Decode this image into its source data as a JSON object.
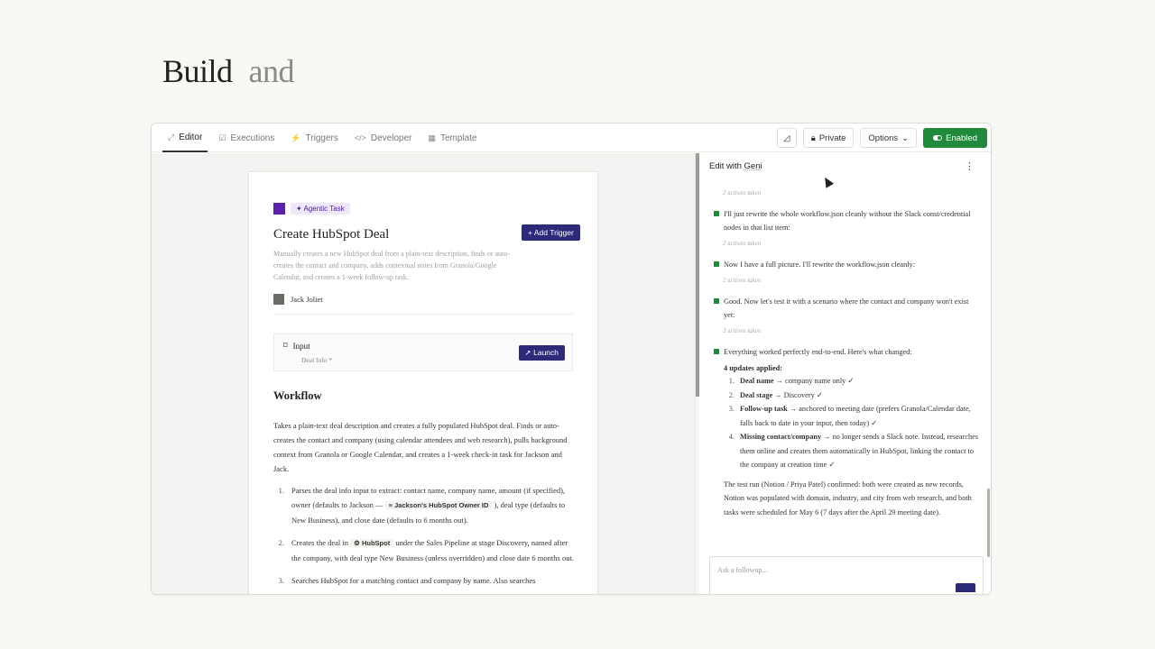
{
  "hero": {
    "word1": "Build",
    "word2": "and"
  },
  "tabs": [
    {
      "label": "Editor",
      "icon": "pencil-icon",
      "glyph": "⤢"
    },
    {
      "label": "Executions",
      "icon": "checkbox-icon",
      "glyph": "☑"
    },
    {
      "label": "Triggers",
      "icon": "lightning-icon",
      "glyph": "⚡"
    },
    {
      "label": "Developer",
      "icon": "code-icon",
      "glyph": "</>"
    },
    {
      "label": "Template",
      "icon": "grid-icon",
      "glyph": "▦"
    }
  ],
  "controls": {
    "private": "Private",
    "options": "Options",
    "enabled": "Enabled"
  },
  "card": {
    "badge": "Agentic Task",
    "add_trigger": "+ Add Trigger",
    "title": "Create HubSpot Deal",
    "description": "Manually creates a new HubSpot deal from a plain-text description, finds or auto-creates the contact and company, adds contextual notes from Granola/Google Calendar, and creates a 1-week follow-up task.",
    "author": "Jack Joliet",
    "input_label": "Input",
    "input_sub": "Deal Info *",
    "launch": "Launch",
    "workflow_title": "Workflow",
    "workflow_desc": "Takes a plain-text deal description and creates a fully populated HubSpot deal. Finds or auto-creates the contact and company (using calendar attendees and web research), pulls background context from Granola or Google Calendar, and creates a 1-week check-in task for Jackson and Jack.",
    "steps": [
      {
        "n": "1.",
        "a": "Parses the deal info input to extract: contact name, company name, amount (if specified), owner (defaults to Jackson —",
        "pill": "≡ Jackson's HubSpot Owner ID",
        "b": "), deal type (defaults to New Business), and close date (defaults to 6 months out)."
      },
      {
        "n": "2.",
        "a": "Creates the deal in",
        "pill": "⚙ HubSpot",
        "b": "under the Sales Pipeline at stage Discovery, named after the company, with deal type New Business (unless overridden) and close date 6 months out."
      },
      {
        "n": "3.",
        "a": "Searches HubSpot for a matching contact and company by name. Also searches",
        "pill": "",
        "b": ""
      }
    ]
  },
  "geni": {
    "header_prefix": "Edit with",
    "header_name": "Geni",
    "messages": [
      {
        "meta": "2 actions taken",
        "text": "I'll just rewrite the whole workflow.json cleanly without the Slack const/credential nodes in that list item:"
      },
      {
        "meta": "2 actions taken",
        "text": "Now I have a full picture. I'll rewrite the workflow.json cleanly:"
      },
      {
        "meta": "2 actions taken",
        "text": "Good. Now let's test it with a scenario where the contact and company won't exist yet:"
      },
      {
        "meta": "3 actions taken",
        "text": "Everything worked perfectly end-to-end. Here's what changed:"
      }
    ],
    "updates_title": "4 updates applied:",
    "updates": [
      {
        "n": "1.",
        "bold": "Deal name",
        "text": " → company name only ✓"
      },
      {
        "n": "2.",
        "bold": "Deal stage",
        "text": " → Discovery ✓"
      },
      {
        "n": "3.",
        "bold": "Follow-up task",
        "text": " → anchored to meeting date (prefers Granola/Calendar date, falls back to date in your input, then today) ✓"
      },
      {
        "n": "4.",
        "bold": "Missing contact/company",
        "text": " → no longer sends a Slack note. Instead, researches them online and creates them automatically in HubSpot, linking the contact to the company at creation time ✓"
      }
    ],
    "summary": "The test run (Notion / Priya Patel) confirmed: both were created as new records, Notion was populated with domain, industry, and city from web research, and both tasks were scheduled for May 6 (7 days after the April 29 meeting date).",
    "followup_placeholder": "Ask a followup..."
  }
}
